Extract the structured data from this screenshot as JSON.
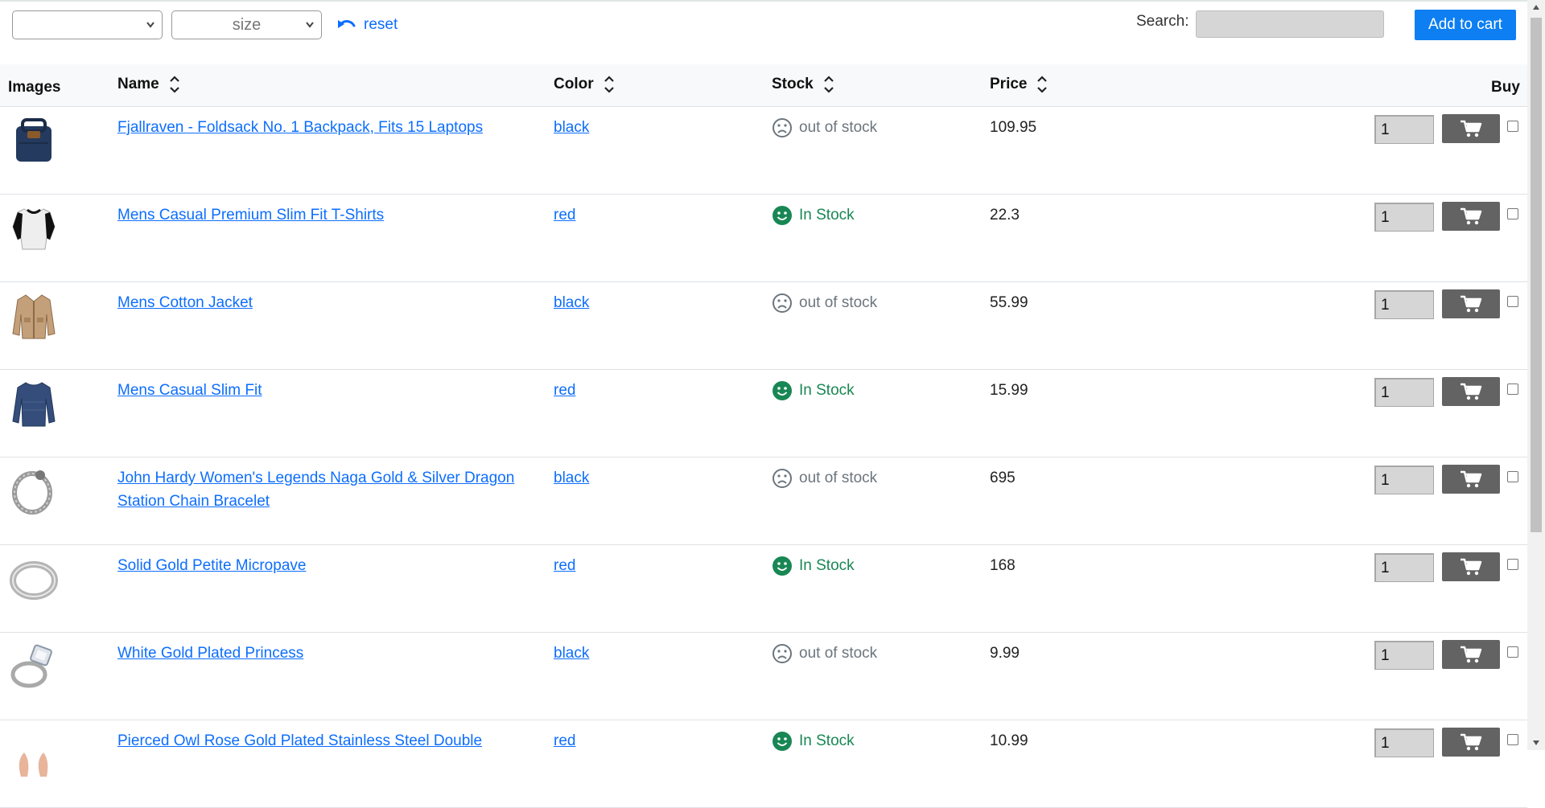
{
  "toolbar": {
    "select1_value": "",
    "select2_value": "size",
    "reset_label": "reset",
    "search_label": "Search:",
    "search_value": "",
    "add_to_cart_label": "Add to cart"
  },
  "table": {
    "headers": {
      "images": "Images",
      "name": "Name",
      "color": "Color",
      "stock": "Stock",
      "price": "Price",
      "buy": "Buy"
    },
    "rows": [
      {
        "name": "Fjallraven - Foldsack No. 1 Backpack, Fits 15 Laptops",
        "color": "black",
        "stock": "out of stock",
        "in_stock": false,
        "price": "109.95",
        "qty": "1",
        "image": "backpack-image"
      },
      {
        "name": "Mens Casual Premium Slim Fit T-Shirts",
        "color": "red",
        "stock": "In Stock",
        "in_stock": true,
        "price": "22.3",
        "qty": "1",
        "image": "tshirt-image"
      },
      {
        "name": "Mens Cotton Jacket",
        "color": "black",
        "stock": "out of stock",
        "in_stock": false,
        "price": "55.99",
        "qty": "1",
        "image": "jacket-image"
      },
      {
        "name": "Mens Casual Slim Fit",
        "color": "red",
        "stock": "In Stock",
        "in_stock": true,
        "price": "15.99",
        "qty": "1",
        "image": "longsleeve-image"
      },
      {
        "name": "John Hardy Women's Legends Naga Gold & Silver Dragon Station Chain Bracelet",
        "color": "black",
        "stock": "out of stock",
        "in_stock": false,
        "price": "695",
        "qty": "1",
        "image": "bracelet-image"
      },
      {
        "name": "Solid Gold Petite Micropave",
        "color": "red",
        "stock": "In Stock",
        "in_stock": true,
        "price": "168",
        "qty": "1",
        "image": "ring-image"
      },
      {
        "name": "White Gold Plated Princess",
        "color": "black",
        "stock": "out of stock",
        "in_stock": false,
        "price": "9.99",
        "qty": "1",
        "image": "diamond-ring-image"
      },
      {
        "name": "Pierced Owl Rose Gold Plated Stainless Steel Double",
        "color": "red",
        "stock": "In Stock",
        "in_stock": true,
        "price": "10.99",
        "qty": "1",
        "image": "earrings-image"
      }
    ]
  },
  "colors": {
    "link": "#0d6efd",
    "in_stock": "#198754",
    "out_of_stock": "#6c757d",
    "add_to_cart_bg": "#0d7ff2",
    "cart_button_bg": "#636363"
  },
  "icons": {
    "reset": "undo-icon",
    "sort": "sort-icon",
    "in_stock": "smile-icon",
    "out_of_stock": "frown-icon",
    "cart": "cart-icon"
  }
}
